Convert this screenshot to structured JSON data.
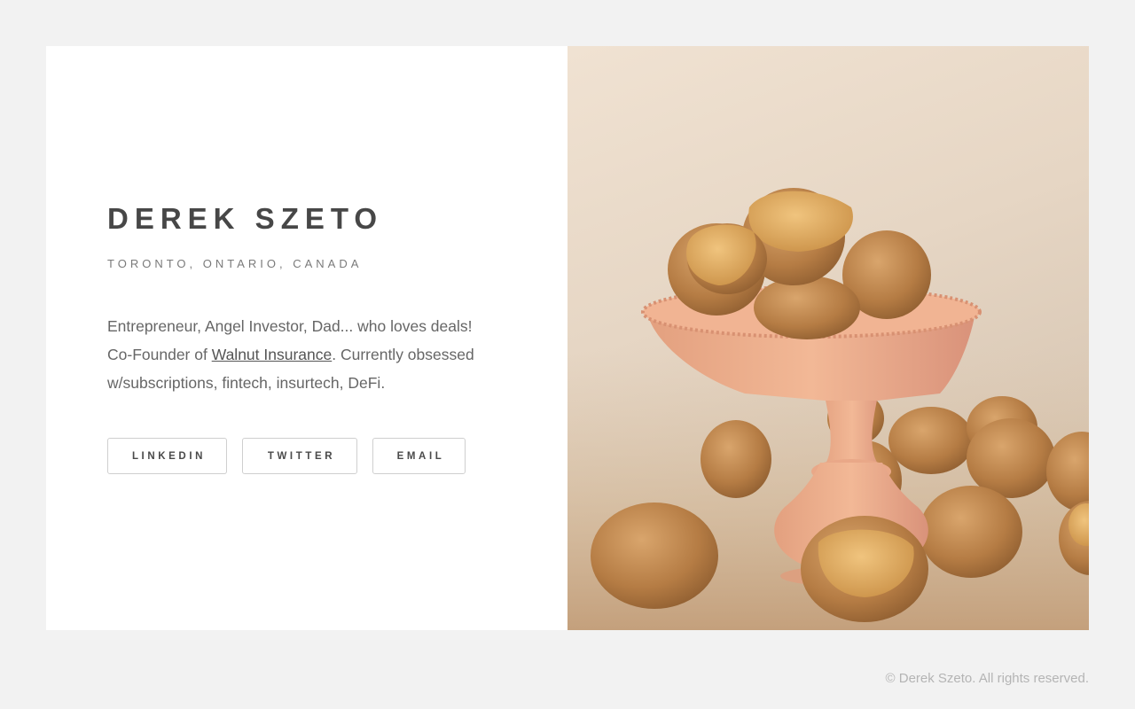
{
  "profile": {
    "name": "DEREK SZETO",
    "location": "TORONTO, ONTARIO, CANADA",
    "bio_prefix": "Entrepreneur, Angel Investor, Dad... who loves deals! Co-Founder of ",
    "bio_link": "Walnut Insurance",
    "bio_suffix": ". Currently obsessed w/subscriptions, fintech, insurtech, DeFi."
  },
  "buttons": {
    "linkedin": "LINKEDIN",
    "twitter": "TWITTER",
    "email": "EMAIL"
  },
  "footer": {
    "copyright": "© Derek Szeto. All rights reserved."
  },
  "colors": {
    "page_background": "#f2f2f2",
    "card_background": "#ffffff",
    "heading": "#474747",
    "body_text": "#666666",
    "button_border": "#cfcfcf",
    "footer_text": "#b4b4b4"
  }
}
